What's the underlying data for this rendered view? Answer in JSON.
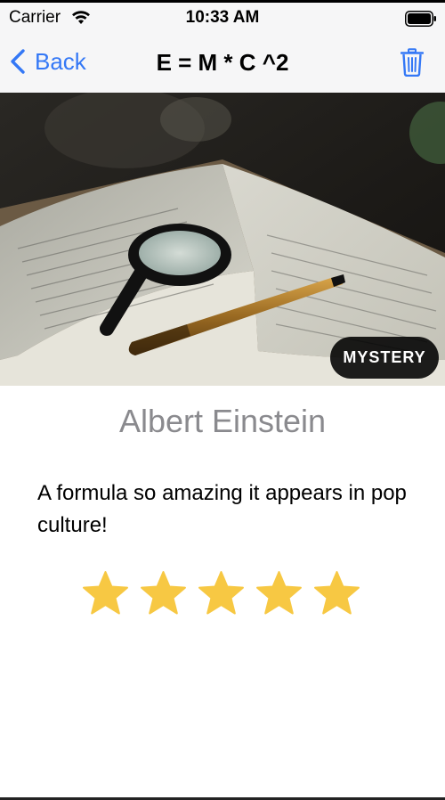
{
  "status_bar": {
    "carrier": "Carrier",
    "time": "10:33 AM",
    "icons": [
      "wifi-icon",
      "battery-icon"
    ]
  },
  "nav": {
    "back_label": "Back",
    "title": "E = M * C ^2",
    "back_icon": "chevron-left-icon",
    "action_icon": "trash-icon",
    "accent_color": "#3478f6"
  },
  "hero": {
    "badge": "MYSTERY"
  },
  "quote": {
    "author": "Albert Einstein",
    "description": "A formula so amazing it appears in pop culture!",
    "rating": 5,
    "rating_max": 5,
    "star_color": "#f7c843"
  }
}
